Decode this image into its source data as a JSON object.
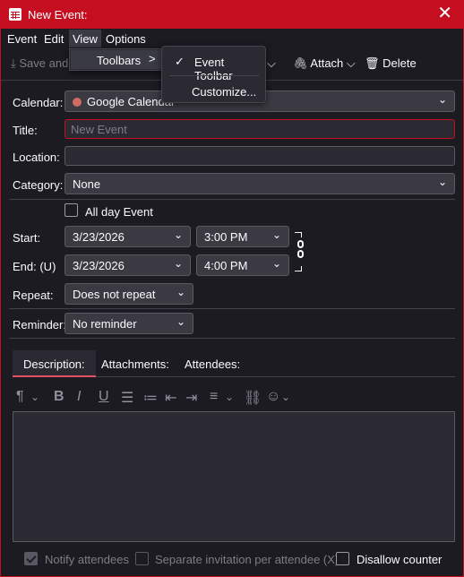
{
  "window": {
    "title": "New Event:",
    "close": "✕"
  },
  "menubar": {
    "event": "Event",
    "edit": "Edit",
    "view": "View",
    "options": "Options"
  },
  "toolbar": {
    "save_and": "Save and",
    "attach": "Attach",
    "delete": "Delete"
  },
  "view_menu": {
    "toolbars": "Toolbars",
    "arrow": ">"
  },
  "toolbars_submenu": {
    "event_toolbar": "Event Toolbar",
    "customize": "Customize..."
  },
  "form": {
    "calendar_label": "Calendar:",
    "calendar_value": "Google Calendar",
    "title_label": "Title:",
    "title_placeholder": "New Event",
    "location_label": "Location:",
    "category_label": "Category:",
    "category_value": "None",
    "allday_label": "All day Event",
    "start_label": "Start:",
    "start_date": "3/23/2026",
    "start_time": "3:00 PM",
    "end_label": "End: (U)",
    "end_date": "3/23/2026",
    "end_time": "4:00 PM",
    "repeat_label": "Repeat:",
    "repeat_value": "Does not repeat",
    "reminder_label": "Reminder:",
    "reminder_value": "No reminder"
  },
  "tabs": {
    "description": "Description:",
    "attachments": "Attachments:",
    "attendees": "Attendees:"
  },
  "footer": {
    "notify_attendees": "Notify attendees",
    "separate_invitation": "Separate invitation per attendee (X)",
    "disallow_counter": "Disallow counter"
  },
  "colors": {
    "accent": "#c50e20",
    "calendar_dot": "#d06b64",
    "background": "#1c1b22"
  }
}
